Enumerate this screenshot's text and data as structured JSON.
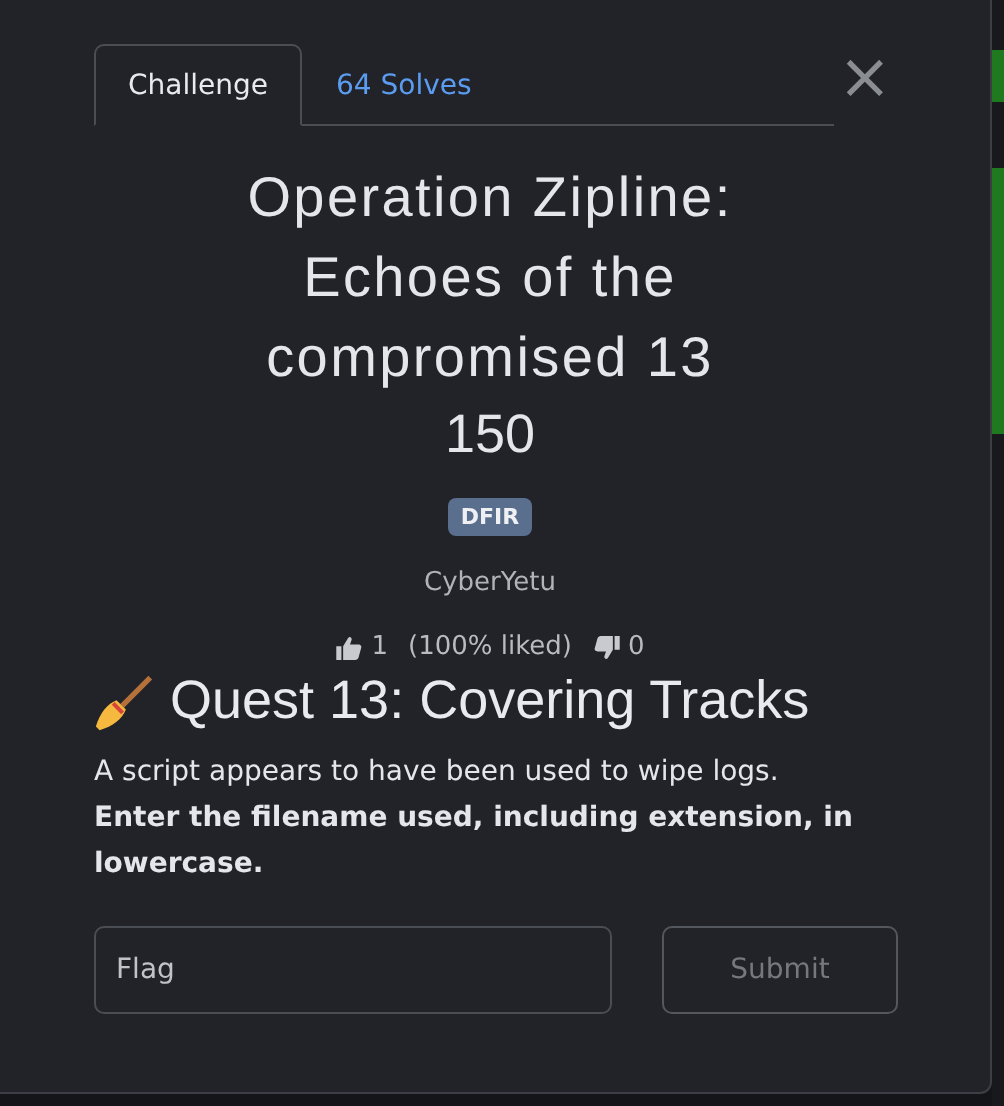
{
  "tabs": [
    {
      "label": "Challenge",
      "selected": true
    },
    {
      "label": "64 Solves",
      "selected": false
    }
  ],
  "close": "×",
  "challenge": {
    "name": "Operation Zipline: Echoes of the compromised 13",
    "value": "150",
    "tags": [
      "DFIR"
    ],
    "author": "CyberYetu",
    "likes": "1",
    "liked_share": "(100% liked)",
    "dislikes": "0"
  },
  "description": {
    "heading": "Quest 13: Covering Tracks",
    "text": "A script appears to have been used to wipe logs.",
    "instruction": "Enter the filename used, including extension, in lowercase."
  },
  "flag_field": {
    "placeholder": "Flag"
  },
  "submit": {
    "label": "Submit",
    "disabled": true
  }
}
